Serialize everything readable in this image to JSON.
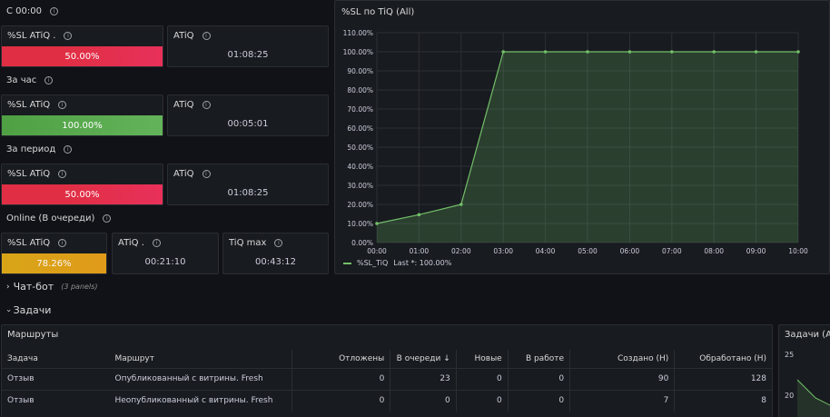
{
  "sections": {
    "s1_title": "С 00:00",
    "s2_title": "За час",
    "s3_title": "За период",
    "s4_title": "Online (В очереди)"
  },
  "stats": {
    "s1": {
      "sl_label": "%SL ATiQ .",
      "sl_value": "50.00%",
      "atiq_label": "ATiQ",
      "atiq_value": "01:08:25"
    },
    "s2": {
      "sl_label": "%SL ATiQ",
      "sl_value": "100.00%",
      "atiq_label": "ATiQ",
      "atiq_value": "00:05:01"
    },
    "s3": {
      "sl_label": "%SL ATiQ",
      "sl_value": "50.00%",
      "atiq_label": "ATiQ",
      "atiq_value": "01:08:25"
    },
    "s4": {
      "sl_label": "%SL ATiQ",
      "sl_value": "78.26%",
      "atiq_label": "ATiQ .",
      "atiq_value": "00:21:10",
      "tiq_label": "TiQ max",
      "tiq_value": "00:43:12"
    }
  },
  "colors": {
    "red": "#e02f44",
    "green": "#56a64b",
    "amber": "#e0a716",
    "series": "#73bf69"
  },
  "rows": {
    "chatbot": {
      "label": "Чат-бот",
      "count": "(3 panels)"
    },
    "tasks": {
      "label": "Задачи"
    }
  },
  "routes_panel": {
    "title": "Маршруты",
    "headers": [
      "Задача",
      "Маршрут",
      "Отложены",
      "В очереди ↓",
      "Новые",
      "В работе",
      "Создано (Н)",
      "Обработано (Н)"
    ],
    "rows": [
      [
        "Отзыв",
        "Опубликованный с витрины. Fresh",
        "0",
        "23",
        "0",
        "0",
        "90",
        "128"
      ],
      [
        "Отзыв",
        "Неопубликованный с витрины. Fresh",
        "0",
        "0",
        "0",
        "0",
        "7",
        "8"
      ]
    ]
  },
  "tasks_panel": {
    "title": "Задачи (All",
    "ticks": [
      "25",
      "20"
    ]
  },
  "chart_panel": {
    "title": "%SL по TiQ (All)",
    "legend": "%SL_TiQ",
    "legend_last": "Last *: 100.00%"
  },
  "chart_data": {
    "type": "area",
    "title": "%SL по TiQ (All)",
    "x": [
      "00:00",
      "01:00",
      "02:00",
      "03:00",
      "04:00",
      "05:00",
      "06:00",
      "07:00",
      "08:00",
      "09:00",
      "10:00"
    ],
    "series": [
      {
        "name": "%SL_TiQ",
        "values": [
          10,
          14.6,
          20,
          100,
          100,
          100,
          100,
          100,
          100,
          100,
          100
        ]
      }
    ],
    "y_ticks": [
      "0.00%",
      "10.00%",
      "20.00%",
      "30.00%",
      "40.00%",
      "50.00%",
      "60.00%",
      "70.00%",
      "80.00%",
      "90.00%",
      "100.00%",
      "110.00%"
    ],
    "ylim": [
      0,
      110
    ],
    "grid": true,
    "legend_position": "bottom-left"
  }
}
